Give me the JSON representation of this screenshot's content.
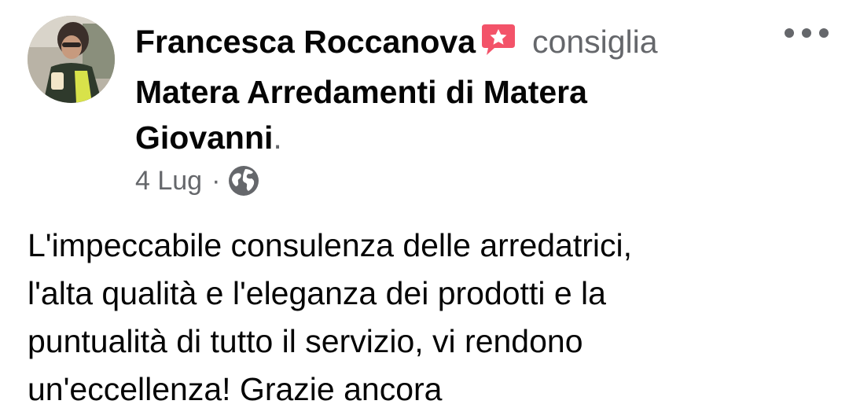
{
  "post": {
    "author_name": "Francesca Roccanova",
    "action_verb": "consiglia",
    "page_name": "Matera Arredamenti di Matera Giovanni",
    "page_name_lines": [
      "Matera Arredamenti di Matera",
      "Giovanni"
    ],
    "period": ".",
    "date": "4 Lug",
    "separator": "·",
    "audience_icon": "globe-icon",
    "badge_icon": "recommend-star-badge-icon",
    "more_icon": "more-options-icon",
    "body_lines": [
      "L'impeccabile consulenza delle arredatrici,",
      "l'alta qualità e l'eleganza dei prodotti e la",
      "puntualità di tutto il servizio, vi rendono",
      "un'eccellenza! Grazie ancora"
    ]
  },
  "colors": {
    "primary_text": "#050505",
    "secondary_text": "#65676b",
    "badge_pink": "#f35369"
  }
}
